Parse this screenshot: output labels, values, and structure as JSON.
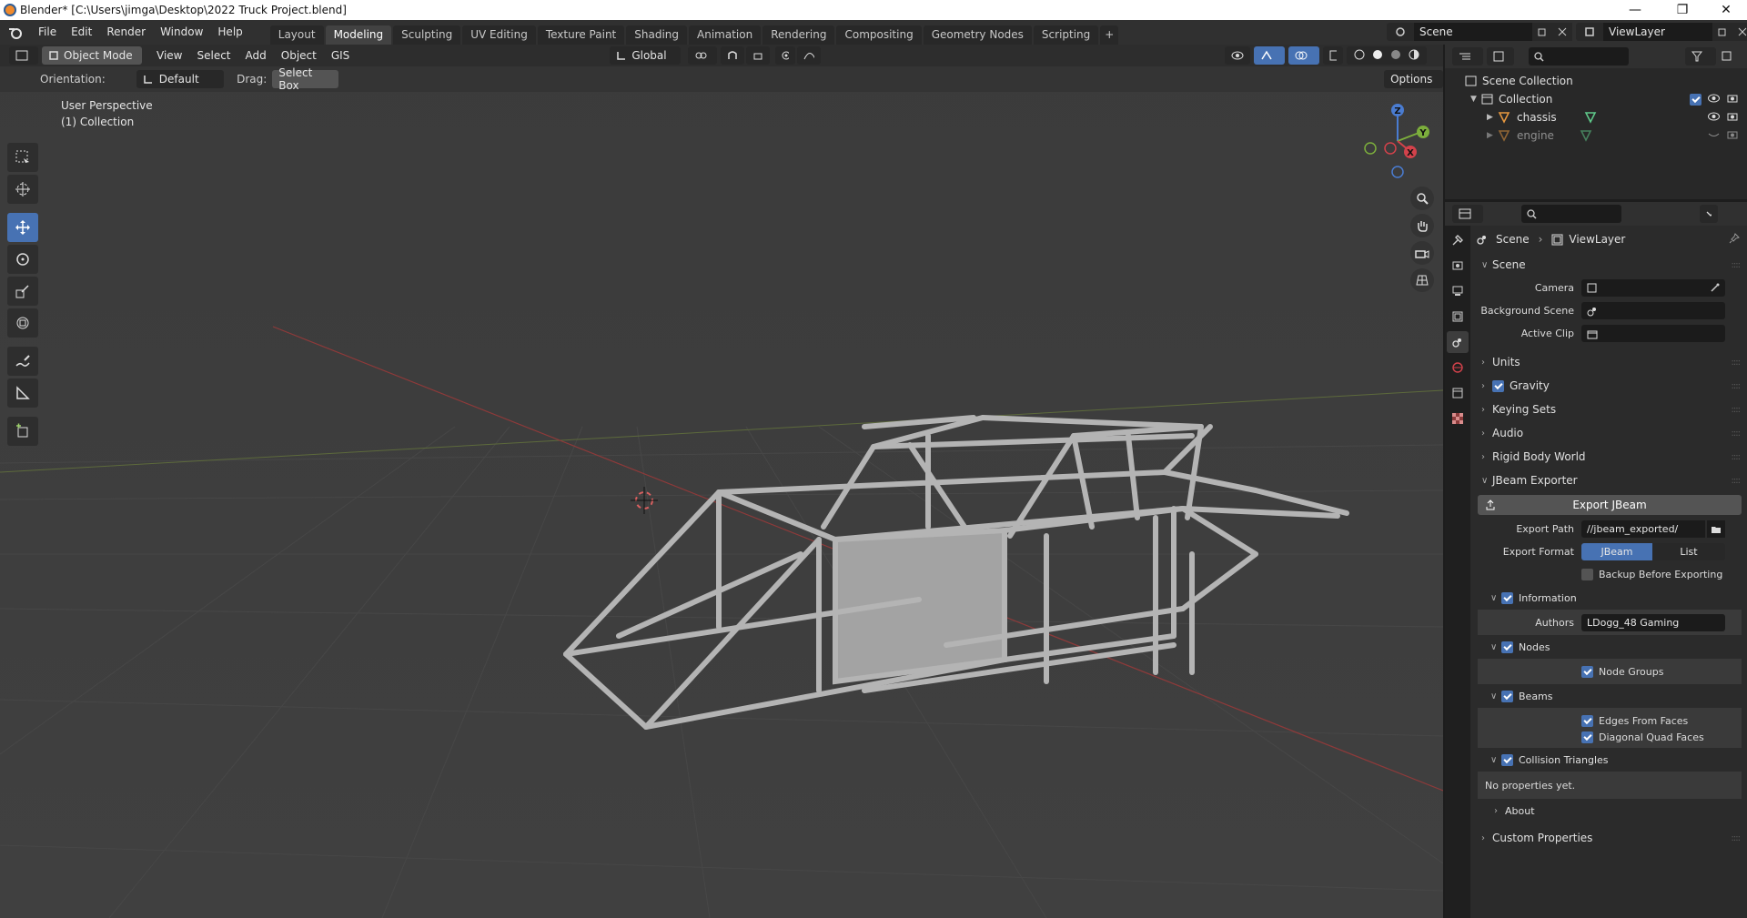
{
  "window": {
    "title": "Blender* [C:\\Users\\jimga\\Desktop\\2022 Truck Project.blend]"
  },
  "topbar": {
    "menus": [
      "File",
      "Edit",
      "Render",
      "Window",
      "Help"
    ],
    "workspaces": [
      "Layout",
      "Modeling",
      "Sculpting",
      "UV Editing",
      "Texture Paint",
      "Shading",
      "Animation",
      "Rendering",
      "Compositing",
      "Geometry Nodes",
      "Scripting"
    ],
    "active_workspace": "Modeling",
    "scene": "Scene",
    "view_layer": "ViewLayer"
  },
  "viewport": {
    "mode": "Object Mode",
    "menus": [
      "View",
      "Select",
      "Add",
      "Object",
      "GIS"
    ],
    "transform_orientation": "Global",
    "orientation_label": "Orientation:",
    "orientation_value": "Default",
    "drag_label": "Drag:",
    "drag_value": "Select Box",
    "options": "Options",
    "overlay_line1": "User Perspective",
    "overlay_line2": "(1) Collection",
    "gizmo_axes": {
      "x": "X",
      "y": "Y",
      "z": "Z"
    }
  },
  "outliner": {
    "root": "Scene Collection",
    "collection": "Collection",
    "items": [
      "chassis",
      "engine"
    ]
  },
  "properties": {
    "breadcrumb_scene": "Scene",
    "breadcrumb_layer": "ViewLayer",
    "scene_panel": "Scene",
    "camera_label": "Camera",
    "background_label": "Background Scene",
    "clip_label": "Active Clip",
    "sections": [
      "Units",
      "Gravity",
      "Keying Sets",
      "Audio",
      "Rigid Body World"
    ],
    "exporter": {
      "title": "JBeam Exporter",
      "export_button": "Export JBeam",
      "path_label": "Export Path",
      "path_value": "//jbeam_exported/",
      "format_label": "Export Format",
      "format_options": [
        "JBeam",
        "List"
      ],
      "format_selected": "JBeam",
      "backup_label": "Backup Before Exporting",
      "information": "Information",
      "authors_label": "Authors",
      "authors_value": "LDogg_48 Gaming",
      "nodes": "Nodes",
      "node_groups": "Node Groups",
      "beams": "Beams",
      "edges_from_faces": "Edges From Faces",
      "diagonal_quad_faces": "Diagonal Quad Faces",
      "collision": "Collision Triangles",
      "no_props": "No properties yet.",
      "about": "About"
    },
    "custom_properties": "Custom Properties"
  },
  "colors": {
    "accent": "#4772b3",
    "viewport_bg": "#3d3d3d",
    "model": "#b4b4b4"
  }
}
